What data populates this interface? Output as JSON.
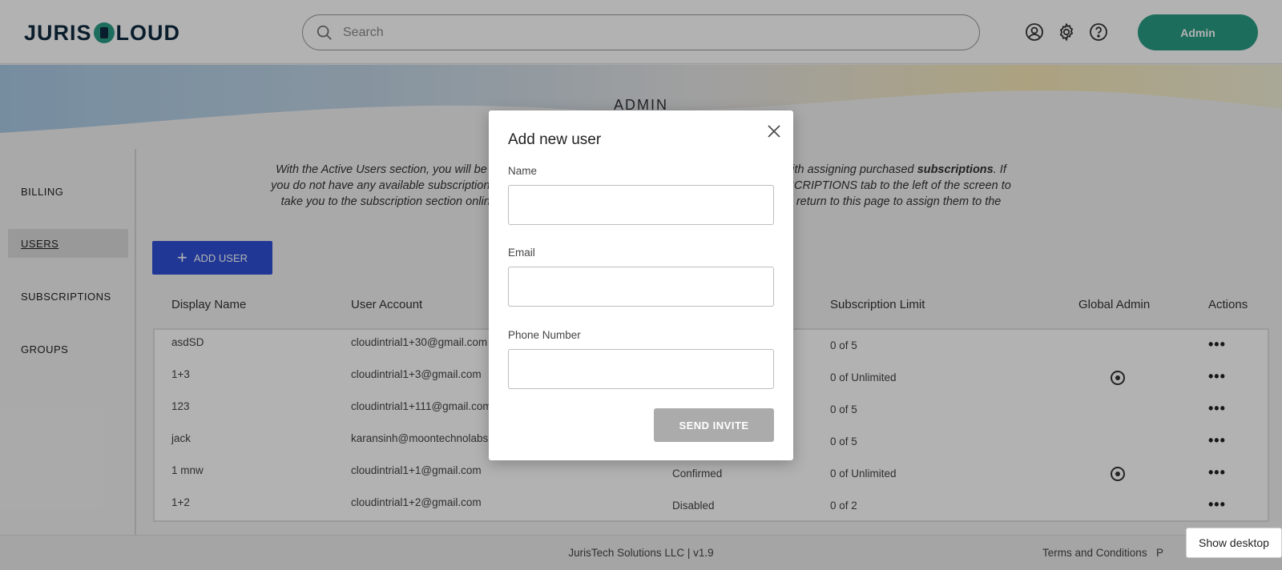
{
  "header": {
    "logo_left": "JURIS",
    "logo_right": "LOUD",
    "search_placeholder": "Search",
    "admin_label": "Admin"
  },
  "page": {
    "title": "ADMIN",
    "desc_line1_a": "With the Active Users section, you will be",
    "desc_line1_b": "with assigning purchased",
    "desc_line1_bold": "subscriptions",
    "desc_line1_c": ". If",
    "desc_line2_a": "you do not have any available subscription",
    "desc_line2_b": "SCRIPTIONS tab to the left of the screen to",
    "desc_line3_a": "take you to the subscription section onlin",
    "desc_line3_b": "n return to this page to assign them to the"
  },
  "sidebar": {
    "items": [
      {
        "label": "BILLING"
      },
      {
        "label": "USERS"
      },
      {
        "label": "SUBSCRIPTIONS"
      },
      {
        "label": "GROUPS"
      }
    ]
  },
  "add_user_label": "ADD USER",
  "table": {
    "headers": {
      "display_name": "Display Name",
      "user_account": "User Account",
      "subscription_limit": "Subscription Limit",
      "global_admin": "Global Admin",
      "actions": "Actions"
    },
    "rows": [
      {
        "name": "asdSD",
        "account": "cloudintrial1+30@gmail.com",
        "status": "",
        "limit": "0 of 5",
        "admin": false
      },
      {
        "name": "1+3",
        "account": "cloudintrial1+3@gmail.com",
        "status": "",
        "limit": "0 of Unlimited",
        "admin": true
      },
      {
        "name": "123",
        "account": "cloudintrial1+111@gmail.com",
        "status": "",
        "limit": "0 of 5",
        "admin": false
      },
      {
        "name": "jack",
        "account": "karansinh@moontechnolabs",
        "status": "",
        "limit": "0 of 5",
        "admin": false
      },
      {
        "name": "1 mnw",
        "account": "cloudintrial1+1@gmail.com",
        "status": "Confirmed",
        "limit": "0 of Unlimited",
        "admin": true
      },
      {
        "name": "1+2",
        "account": "cloudintrial1+2@gmail.com",
        "status": "Disabled",
        "limit": "0 of 2",
        "admin": false
      }
    ],
    "actions_glyph": "•••"
  },
  "footer": {
    "text": "JurisTech Solutions LLC | v1.9",
    "terms": "Terms and Conditions",
    "terms2": "P"
  },
  "modal": {
    "title": "Add new user",
    "name_label": "Name",
    "email_label": "Email",
    "phone_label": "Phone Number",
    "name_value": "",
    "email_value": "",
    "phone_value": "",
    "send_label": "SEND INVITE"
  },
  "tooltip": {
    "show_desktop": "Show desktop"
  },
  "colors": {
    "brand_teal": "#2a9d86",
    "brand_navy": "#0f2a3f",
    "add_user_blue": "#2f4fd6",
    "send_disabled": "#ababab"
  },
  "icons": {
    "search": "search-icon",
    "account": "user-circle-icon",
    "settings": "gear-icon",
    "help": "help-circle-icon",
    "close": "close-icon",
    "plus": "plus-icon"
  }
}
